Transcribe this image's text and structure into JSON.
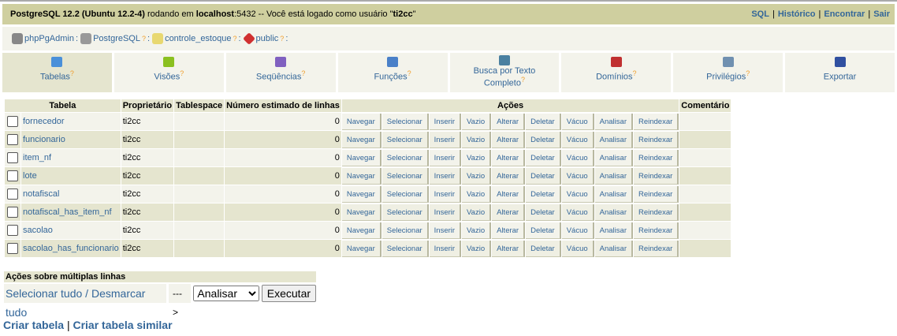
{
  "topbar": {
    "server": "PostgreSQL 12.2 (Ubuntu 12.2-4)",
    "running": " rodando em ",
    "host": "localhost",
    "port": ":5432 -- Você está logado como usuário \"",
    "user": "ti2cc",
    "end": "\"",
    "links": [
      "SQL",
      "Histórico",
      "Encontrar",
      "Sair"
    ]
  },
  "trail": [
    {
      "label": "phpPgAdmin",
      "suffix": ":",
      "icon": "elephant-icon",
      "color": "#888"
    },
    {
      "label": "PostgreSQL",
      "suffix": ":",
      "icon": "server-icon",
      "color": "#999"
    },
    {
      "label": "controle_estoque",
      "suffix": ":",
      "icon": "database-icon",
      "color": "#e8d870"
    },
    {
      "label": "public",
      "suffix": ":",
      "icon": "schema-icon",
      "color": "#d03030"
    }
  ],
  "tabs": [
    {
      "label": "Tabelas",
      "help": "?",
      "color": "#4a90d9",
      "active": true
    },
    {
      "label": "Visões",
      "help": "?",
      "color": "#8ac020"
    },
    {
      "label": "Seqüências",
      "help": "?",
      "color": "#8060c0"
    },
    {
      "label": "Funções",
      "help": "?",
      "color": "#4a80c8"
    },
    {
      "label": "Busca por Texto Completo",
      "help": "?",
      "color": "#4a80a0"
    },
    {
      "label": "Domínios",
      "help": "?",
      "color": "#c03030"
    },
    {
      "label": "Privilégios",
      "help": "?",
      "color": "#7090b0"
    },
    {
      "label": "Exportar",
      "help": "",
      "color": "#3050a0"
    }
  ],
  "table": {
    "headers": [
      "Tabela",
      "Proprietário",
      "Tablespace",
      "Número estimado de linhas",
      "Ações",
      "Comentário"
    ],
    "actions": [
      "Navegar",
      "Selecionar",
      "Inserir",
      "Vazio",
      "Alterar",
      "Deletar",
      "Vácuo",
      "Analisar",
      "Reindexar"
    ],
    "rows": [
      {
        "name": "fornecedor",
        "owner": "ti2cc",
        "tablespace": "",
        "rows": "0",
        "comment": ""
      },
      {
        "name": "funcionario",
        "owner": "ti2cc",
        "tablespace": "",
        "rows": "0",
        "comment": ""
      },
      {
        "name": "item_nf",
        "owner": "ti2cc",
        "tablespace": "",
        "rows": "0",
        "comment": ""
      },
      {
        "name": "lote",
        "owner": "ti2cc",
        "tablespace": "",
        "rows": "0",
        "comment": ""
      },
      {
        "name": "notafiscal",
        "owner": "ti2cc",
        "tablespace": "",
        "rows": "0",
        "comment": ""
      },
      {
        "name": "notafiscal_has_item_nf",
        "owner": "ti2cc",
        "tablespace": "",
        "rows": "0",
        "comment": ""
      },
      {
        "name": "sacolao",
        "owner": "ti2cc",
        "tablespace": "",
        "rows": "0",
        "comment": ""
      },
      {
        "name": "sacolao_has_funcionario",
        "owner": "ti2cc",
        "tablespace": "",
        "rows": "0",
        "comment": ""
      }
    ]
  },
  "multi": {
    "title": "Ações sobre múltiplas linhas",
    "select_all": "Selecionar tudo",
    "slash": " / ",
    "deselect_all": "Desmarcar tudo",
    "arrow": "--->",
    "action_selected": "Analisar",
    "execute": "Executar"
  },
  "bottom": {
    "create": "Criar tabela",
    "sep": "|",
    "create_like": "Criar tabela similar"
  }
}
